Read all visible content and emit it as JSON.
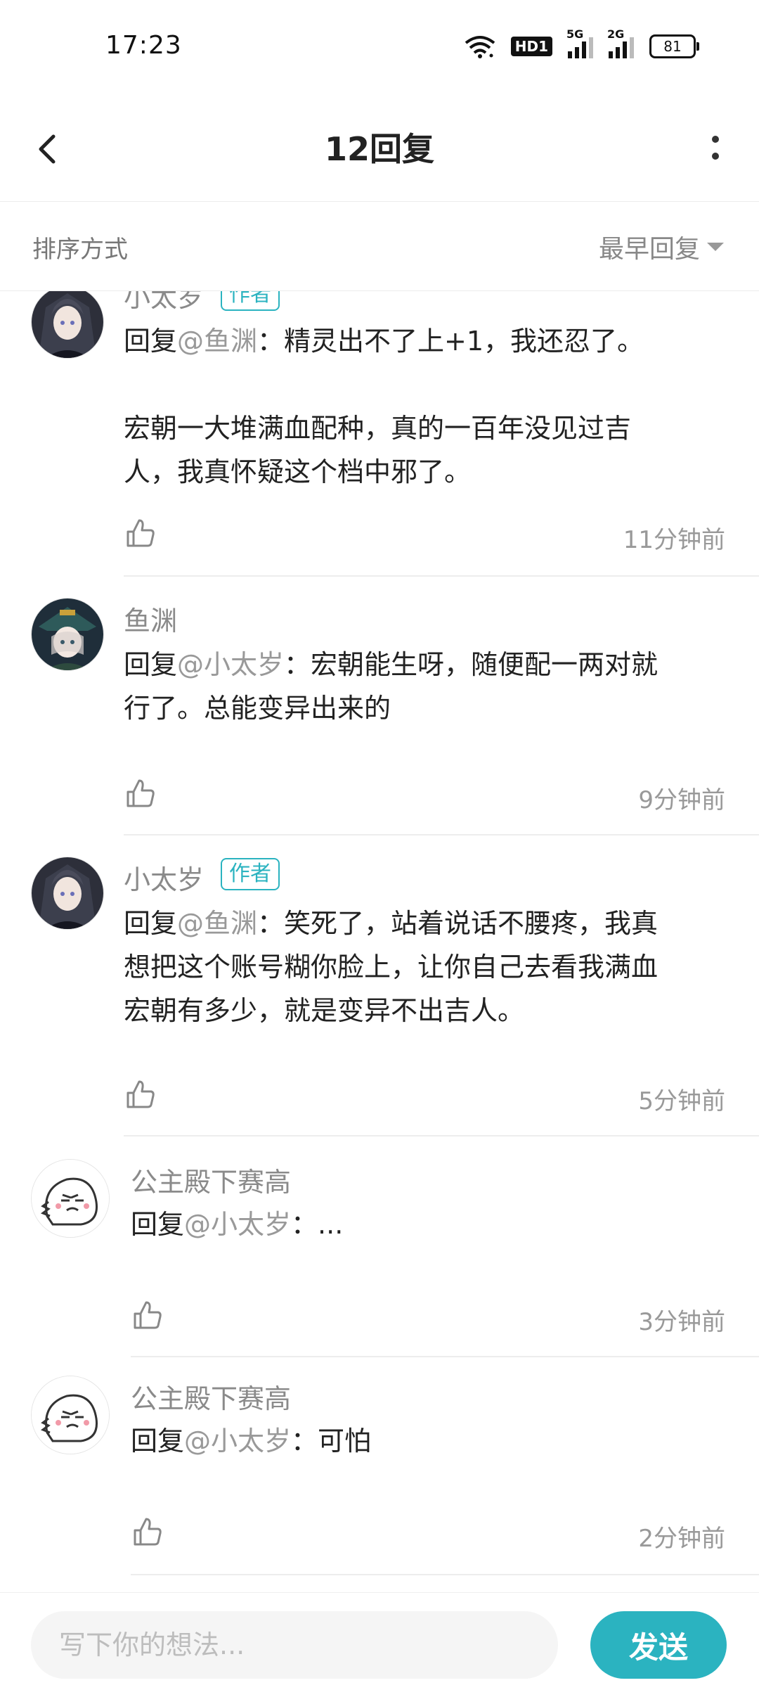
{
  "status_bar": {
    "time": "17:23",
    "network_5g": "5G",
    "network_2g": "2G",
    "hd_label": "HD1",
    "battery": "81"
  },
  "header": {
    "title": "12回复",
    "back_icon": "chevron-left-icon",
    "more_icon": "more-vertical-icon"
  },
  "sort": {
    "label": "排序方式",
    "selected": "最早回复"
  },
  "comments": [
    {
      "username": "小太岁",
      "tag": "作者",
      "reply_prefix": "回复",
      "mention": "@鱼渊",
      "text_lines": [
        "：精灵出不了上+1，我还忍了。",
        "",
        "宏朝一大堆满血配种，真的一百年没见过吉",
        "人，我真怀疑这个档中邪了。"
      ],
      "time": "11分钟前"
    },
    {
      "username": "鱼渊",
      "reply_prefix": "回复",
      "mention": "@小太岁",
      "text_lines": [
        "：宏朝能生呀，随便配一两对就",
        "行了。总能变异出来的"
      ],
      "time": "9分钟前"
    },
    {
      "username": "小太岁",
      "tag": "作者",
      "reply_prefix": "回复",
      "mention": "@鱼渊",
      "text_lines": [
        "：笑死了，站着说话不腰疼，我真",
        "想把这个账号糊你脸上，让你自己去看我满血",
        "宏朝有多少，就是变异不出吉人。"
      ],
      "time": "5分钟前"
    },
    {
      "username": "公主殿下赛高",
      "reply_prefix": "回复",
      "mention": "@小太岁",
      "text_lines": [
        "：..."
      ],
      "time": "3分钟前"
    },
    {
      "username": "公主殿下赛高",
      "reply_prefix": "回复",
      "mention": "@小太岁",
      "text_lines": [
        "：可怕"
      ],
      "time": "2分钟前"
    }
  ],
  "input": {
    "placeholder": "写下你的想法...",
    "send_label": "发送"
  },
  "colors": {
    "accent": "#2bb3c0",
    "muted_text": "#999999",
    "divider": "#ededed"
  }
}
